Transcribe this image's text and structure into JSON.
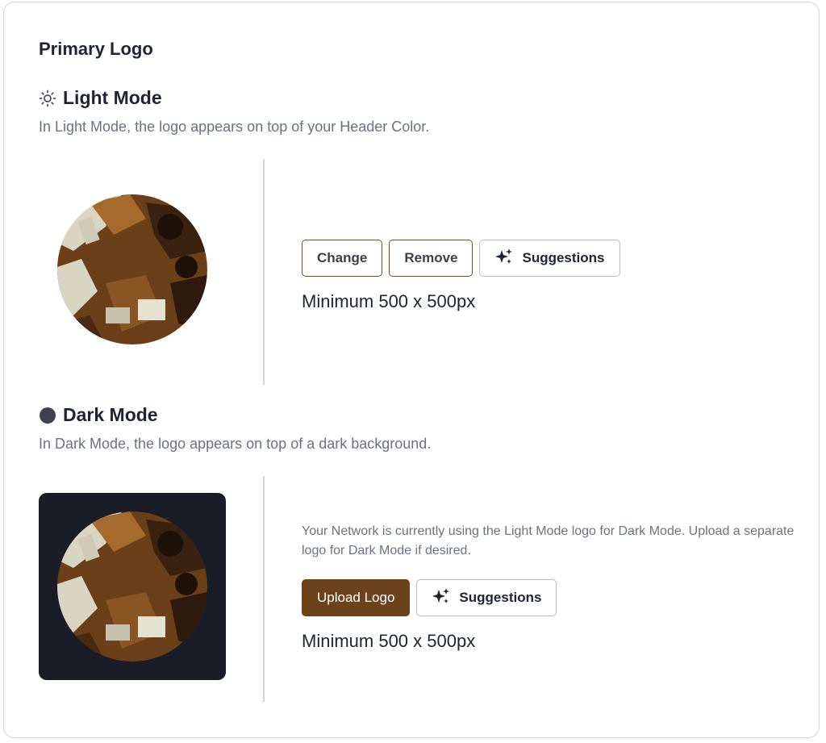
{
  "section_title": "Primary Logo",
  "light_mode": {
    "heading": "Light Mode",
    "icon": "sun-icon",
    "description": "In Light Mode, the logo appears on top of your Header Color.",
    "buttons": {
      "change": "Change",
      "remove": "Remove",
      "suggestions": "Suggestions"
    },
    "min_size": "Minimum 500 x 500px"
  },
  "dark_mode": {
    "heading": "Dark Mode",
    "icon": "moon-icon",
    "description": "In Dark Mode, the logo appears on top of a dark background.",
    "note": "Your Network is currently using the Light Mode logo for Dark Mode. Upload a separate logo for Dark Mode if desired.",
    "buttons": {
      "upload": "Upload Logo",
      "suggestions": "Suggestions"
    },
    "min_size": "Minimum 500 x 500px"
  },
  "colors": {
    "brand_brown": "#6b4219",
    "outline_brown": "#7a4f1e",
    "dark_background": "#1a1d27",
    "muted_text": "#6b7280"
  }
}
